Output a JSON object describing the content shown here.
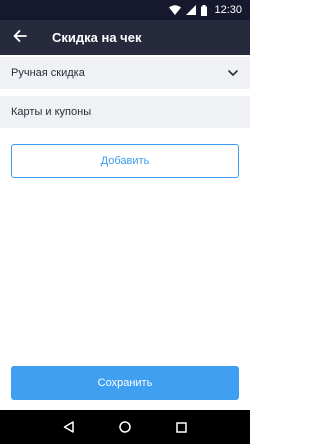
{
  "status_bar": {
    "time": "12:30",
    "icons": [
      "wifi-icon",
      "signal-icon",
      "battery-icon"
    ]
  },
  "app_bar": {
    "title": "Скидка на чек",
    "back_icon": "arrow-left-icon"
  },
  "sections": {
    "manual_discount": {
      "label": "Ручная скидка",
      "icon": "chevron-down-icon"
    },
    "cards_coupons": {
      "label": "Карты и купоны"
    }
  },
  "buttons": {
    "add": "Добавить",
    "save": "Сохранить"
  },
  "nav_bar": {
    "icons": [
      "back-triangle-icon",
      "home-circle-icon",
      "recents-square-icon"
    ]
  },
  "colors": {
    "status_bar": "#16192d",
    "app_bar": "#272a3c",
    "row_background": "#eff1f5",
    "accent": "#3d9cf0"
  }
}
